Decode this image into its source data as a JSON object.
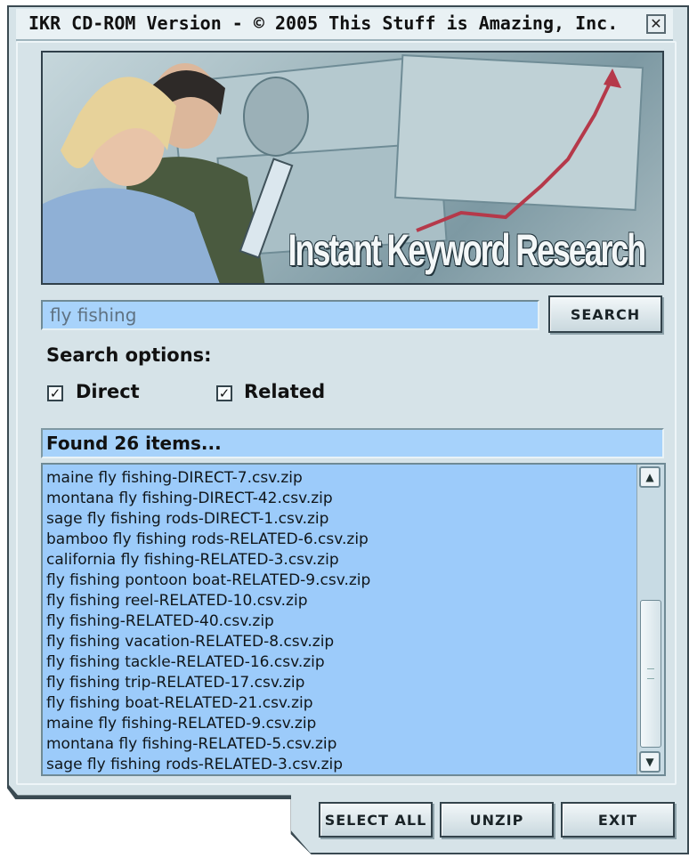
{
  "window": {
    "title": "IKR CD-ROM Version - © 2005 This Stuff is Amazing, Inc.",
    "close_glyph": "✕"
  },
  "banner": {
    "title": "Instant Keyword Research"
  },
  "search": {
    "value": "fly fishing",
    "button_label": "SEARCH"
  },
  "options": {
    "label": "Search options:",
    "direct": {
      "label": "Direct",
      "checked": true,
      "glyph": "✓"
    },
    "related": {
      "label": "Related",
      "checked": true,
      "glyph": "✓"
    }
  },
  "results": {
    "status": "Found 26 items...",
    "items": [
      "maine fly fishing-DIRECT-7.csv.zip",
      "montana fly fishing-DIRECT-42.csv.zip",
      "sage fly fishing rods-DIRECT-1.csv.zip",
      "bamboo fly fishing rods-RELATED-6.csv.zip",
      "california fly fishing-RELATED-3.csv.zip",
      "fly fishing pontoon boat-RELATED-9.csv.zip",
      "fly fishing reel-RELATED-10.csv.zip",
      "fly fishing-RELATED-40.csv.zip",
      "fly fishing vacation-RELATED-8.csv.zip",
      "fly fishing tackle-RELATED-16.csv.zip",
      "fly fishing trip-RELATED-17.csv.zip",
      "fly fishing boat-RELATED-21.csv.zip",
      "maine fly fishing-RELATED-9.csv.zip",
      "montana fly fishing-RELATED-5.csv.zip",
      "sage fly fishing rods-RELATED-3.csv.zip"
    ],
    "scroll_up_glyph": "▲",
    "scroll_down_glyph": "▼"
  },
  "footer": {
    "select_all_label": "SELECT ALL",
    "unzip_label": "UNZIP",
    "exit_label": "EXIT"
  }
}
